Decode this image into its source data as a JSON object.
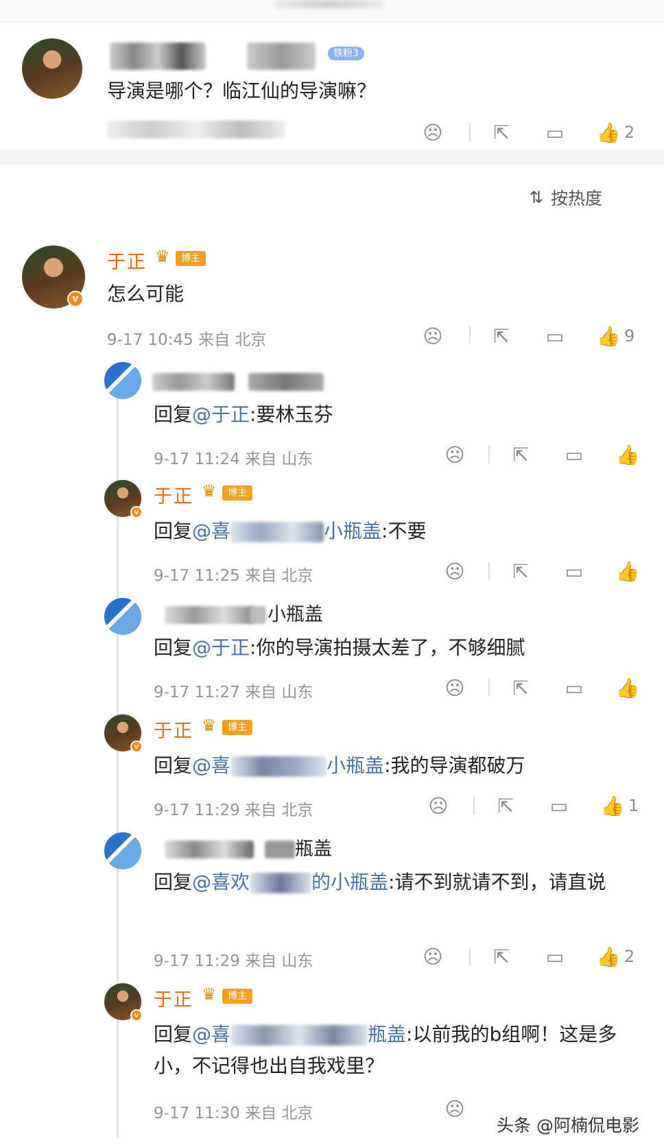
{
  "parent_comment": {
    "text": "导演是哪个？临江仙的导演嘛？",
    "fan_badge": "铁粉3",
    "like_count": "2"
  },
  "sort": {
    "label": "按热度"
  },
  "comments": [
    {
      "name": "于正",
      "badge": "博主",
      "text_before": "",
      "at": "",
      "text_after": "怎么可能",
      "time": "9-17 10:45",
      "source": "来自 北京",
      "likes": "9"
    },
    {
      "name": "",
      "badge": "",
      "text_before": "回复",
      "at": "@于正",
      "text_after": ":要林玉芬",
      "time": "9-17 11:24",
      "source": "来自 山东",
      "likes": ""
    },
    {
      "name": "于正",
      "badge": "博主",
      "text_before": "回复",
      "at": "@喜",
      "at_tail": "小瓶盖",
      "text_after": ":不要",
      "time": "9-17 11:25",
      "source": "来自 北京",
      "likes": ""
    },
    {
      "name_tail": "小瓶盖",
      "badge": "",
      "text_before": "回复",
      "at": "@于正",
      "text_after": ":你的导演拍摄太差了，不够细腻",
      "time": "9-17 11:27",
      "source": "来自 山东",
      "likes": ""
    },
    {
      "name": "于正",
      "badge": "博主",
      "text_before": "回复",
      "at": "@喜",
      "at_tail": "小瓶盖",
      "text_after": ":我的导演都破万",
      "time": "9-17 11:29",
      "source": "来自 北京",
      "likes": "1"
    },
    {
      "name_tail": "瓶盖",
      "badge": "",
      "text_before": "回复",
      "at": "@喜欢",
      "at_tail": "的小瓶盖",
      "text_after": ":请不到就请不到，请直说",
      "time": "9-17 11:29",
      "source": "来自 山东",
      "likes": "2"
    },
    {
      "name": "于正",
      "badge": "博主",
      "text_before": "回复",
      "at": "@喜",
      "at_tail": "瓶盖",
      "text_after": ":以前我的b组啊！这是多小，不记得也出自我戏里？",
      "time": "9-17 11:30",
      "source": "来自 北京",
      "likes": ""
    }
  ],
  "watermark": "头条 @阿楠侃电影",
  "icons": [
    "dislike-icon",
    "share-icon",
    "reply-icon",
    "like-icon",
    "sort-icon",
    "crown-icon",
    "verified-badge-icon"
  ],
  "colors": {
    "name": "#e86a11",
    "badge": "#f49f1d",
    "mention": "#4a6fa5",
    "meta": "#939393"
  }
}
